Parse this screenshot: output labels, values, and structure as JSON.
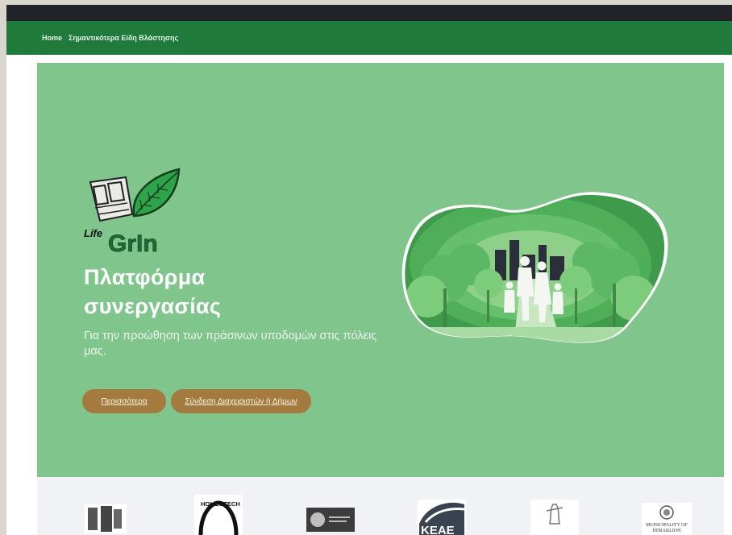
{
  "nav": {
    "items": [
      {
        "label": "Home"
      },
      {
        "label": "Σημαντικότερα Είδη Βλάστησης"
      }
    ]
  },
  "logo": {
    "text_life": "Life",
    "text_brand": "GrIn"
  },
  "hero": {
    "title_line1": "Πλατφόρμα",
    "title_line2": "συνεργασίας",
    "subtitle": "Για την προώθηση των πράσινων υποδομών στις πόλεις μας.",
    "buttons": {
      "more": "Περισσότερα",
      "login": "Σύνδεση Διαχειριστών ή Δήμων"
    }
  },
  "partners": {
    "homeotech": "HOMEOTECH",
    "keae": "KEAE",
    "heraklion_line1": "MUNICIPALITY OF",
    "heraklion_line2": "HERAKLION"
  },
  "colors": {
    "topbar": "#22242a",
    "nav": "#1f7a3c",
    "hero": "#80c58c",
    "button": "#a57a3e",
    "partners_bg": "#f1f2f6"
  }
}
